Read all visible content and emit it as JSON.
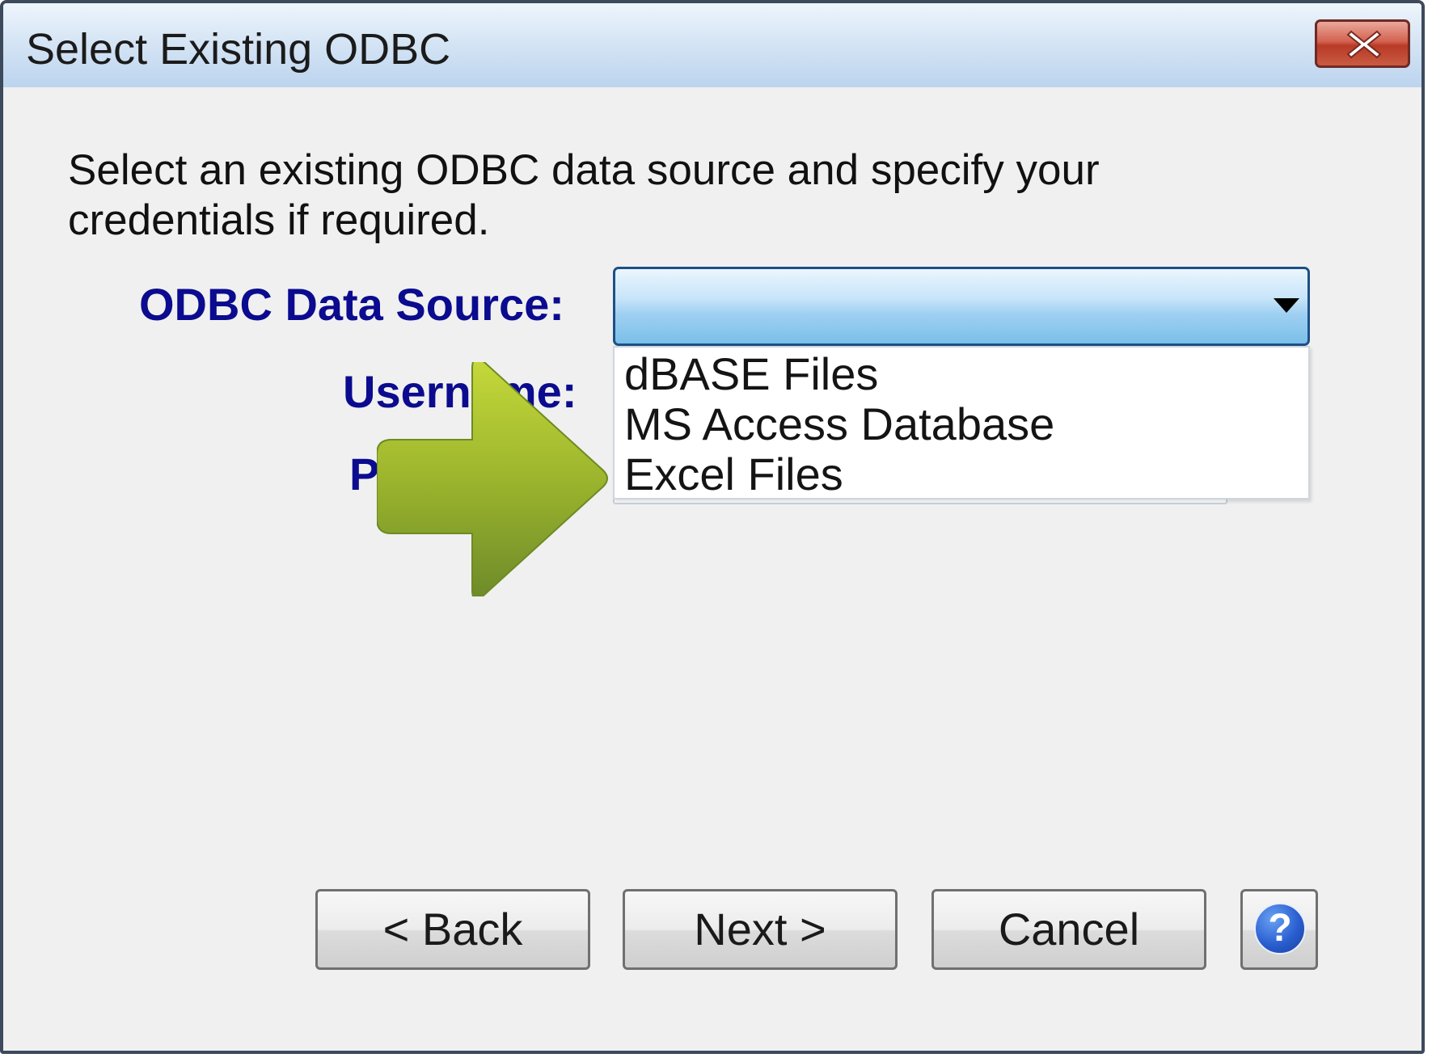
{
  "window": {
    "title": "Select Existing ODBC"
  },
  "form": {
    "description": "Select an existing ODBC data source and specify your credentials if required.",
    "source_label": "ODBC Data Source:",
    "username_label": "Username:",
    "password_label": "P",
    "combo_value": ""
  },
  "dropdown": {
    "options": [
      "dBASE Files",
      "MS Access Database",
      "Excel Files"
    ]
  },
  "buttons": {
    "back": "< Back",
    "next": "Next >",
    "cancel": "Cancel",
    "help": "?"
  },
  "colors": {
    "label_text": "#0b0b8f",
    "combo_border": "#1e4f86",
    "arrow_overlay": "#8fae2c",
    "close_button": "#c44a35"
  },
  "icons": {
    "close": "close-icon",
    "dropdown": "chevron-down-icon",
    "help": "help-icon",
    "pointer": "arrow-right-icon"
  }
}
